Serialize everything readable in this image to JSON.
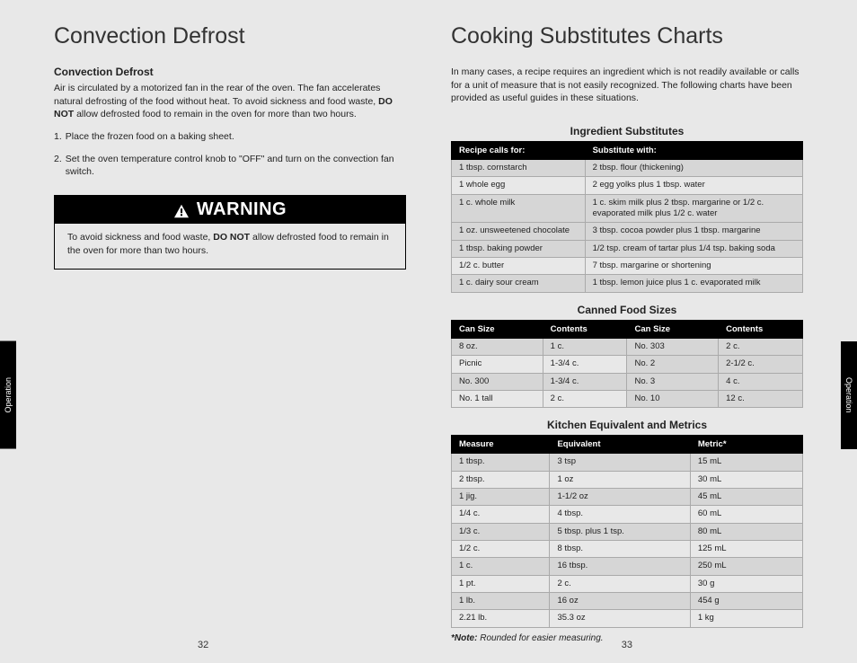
{
  "sideTab": "Operation",
  "leftPage": {
    "number": "32",
    "heading": "Convection Defrost",
    "subheading": "Convection Defrost",
    "intro_a": "Air is circulated by a motorized fan in the rear of the oven. The fan accelerates natural defrosting of the food without heat. To avoid sickness and food waste, ",
    "intro_bold": "DO NOT",
    "intro_b": " allow defrosted food to remain in the oven for more than two hours.",
    "step1_num": "1.",
    "step1": "Place the frozen food on a baking sheet.",
    "step2_num": "2.",
    "step2": "Set the oven temperature control knob to \"OFF\" and turn on the convection fan switch.",
    "warning_label": "WARNING",
    "warning_a": "To avoid sickness and food waste, ",
    "warning_bold": "DO NOT",
    "warning_b": " allow defrosted food to remain in the oven for more than two hours."
  },
  "rightPage": {
    "number": "33",
    "heading": "Cooking Substitutes Charts",
    "intro": "In many cases, a recipe requires an ingredient which is not readily available or calls for a unit of measure that is not easily recognized. The following charts have been provided as useful guides in these situations.",
    "ingredientTitle": "Ingredient Substitutes",
    "ingredientHeaders": {
      "c1": "Recipe calls for:",
      "c2": "Substitute with:"
    },
    "ingredientRows": [
      {
        "c1": "1 tbsp. cornstarch",
        "c2": "2 tbsp. flour (thickening)"
      },
      {
        "c1": "1 whole egg",
        "c2": "2 egg yolks plus 1 tbsp. water"
      },
      {
        "c1": "1 c. whole milk",
        "c2": "1 c. skim milk plus 2 tbsp. margarine or 1/2 c. evaporated milk plus 1/2 c. water"
      },
      {
        "c1": "1 oz. unsweetened chocolate",
        "c2": "3 tbsp. cocoa powder plus 1 tbsp. margarine"
      },
      {
        "c1": "1 tbsp. baking powder",
        "c2": "1/2 tsp. cream of tartar plus 1/4 tsp. baking soda"
      },
      {
        "c1": "1/2 c. butter",
        "c2": "7 tbsp. margarine or shortening"
      },
      {
        "c1": "1 c. dairy sour cream",
        "c2": "1 tbsp. lemon juice plus 1 c. evaporated milk"
      }
    ],
    "cannedTitle": "Canned Food Sizes",
    "cannedHeaders": {
      "c1": "Can Size",
      "c2": "Contents",
      "c3": "Can Size",
      "c4": "Contents"
    },
    "cannedRows": [
      {
        "c1": "8 oz.",
        "c2": "1 c.",
        "c3": "No. 303",
        "c4": "2 c."
      },
      {
        "c1": "Picnic",
        "c2": "1-3/4 c.",
        "c3": "No. 2",
        "c4": "2-1/2 c."
      },
      {
        "c1": "No. 300",
        "c2": "1-3/4 c.",
        "c3": "No. 3",
        "c4": "4 c."
      },
      {
        "c1": "No. 1 tall",
        "c2": "2 c.",
        "c3": "No. 10",
        "c4": "12 c."
      }
    ],
    "metricsTitle": "Kitchen Equivalent and Metrics",
    "metricsHeaders": {
      "c1": "Measure",
      "c2": "Equivalent",
      "c3": "Metric*"
    },
    "metricsRows": [
      {
        "c1": "1 tbsp.",
        "c2": "3 tsp",
        "c3": "15 mL"
      },
      {
        "c1": "2 tbsp.",
        "c2": "1 oz",
        "c3": "30 mL"
      },
      {
        "c1": "1 jig.",
        "c2": "1-1/2 oz",
        "c3": "45 mL"
      },
      {
        "c1": "1/4 c.",
        "c2": "4 tbsp.",
        "c3": "60 mL"
      },
      {
        "c1": "1/3 c.",
        "c2": "5 tbsp. plus 1 tsp.",
        "c3": "80 mL"
      },
      {
        "c1": "1/2 c.",
        "c2": "8 tbsp.",
        "c3": "125 mL"
      },
      {
        "c1": "1 c.",
        "c2": "16 tbsp.",
        "c3": "250 mL"
      },
      {
        "c1": "1 pt.",
        "c2": "2 c.",
        "c3": "30 g"
      },
      {
        "c1": "1 lb.",
        "c2": "16 oz",
        "c3": "454 g"
      },
      {
        "c1": "2.21 lb.",
        "c2": "35.3 oz",
        "c3": "1 kg"
      }
    ],
    "note_label": "*Note:",
    "note_text": " Rounded for easier measuring."
  }
}
